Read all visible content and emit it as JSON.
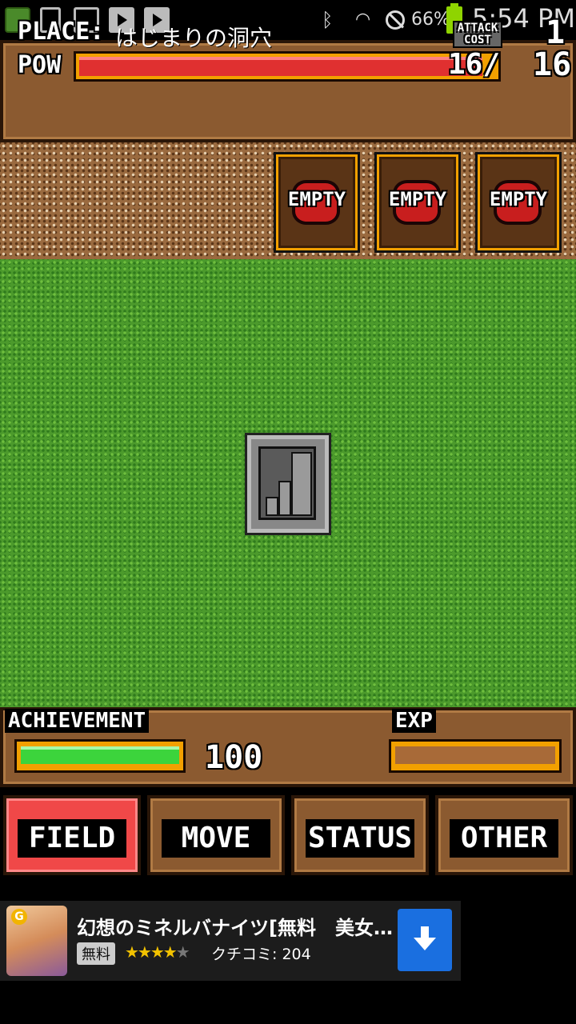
{
  "status_bar": {
    "battery_pct": "66%",
    "time": "5:54 PM",
    "icons": [
      "app-icon",
      "sd-card-icon",
      "image-icon",
      "play-store-icon",
      "play-store-icon",
      "bluetooth-icon",
      "wifi-icon",
      "do-not-disturb-icon",
      "battery-icon"
    ]
  },
  "header": {
    "place_label": "PLACE:",
    "place_value": "はじまりの洞穴",
    "pow_label": "POW",
    "pow_value": "16/",
    "pow_fraction": 0.97,
    "attack_cost_label": "ATTACK COST",
    "attack_cost_value": "1",
    "pow_max": "16"
  },
  "slots": [
    {
      "label": "EMPTY"
    },
    {
      "label": "EMPTY"
    },
    {
      "label": "EMPTY"
    }
  ],
  "footer": {
    "achievement_label": "ACHIEVEMENT",
    "achievement_value": "100",
    "achievement_fraction": 1.0,
    "exp_label": "EXP",
    "exp_fraction": 0.0
  },
  "nav": [
    {
      "label": "FIELD",
      "active": true
    },
    {
      "label": "MOVE",
      "active": false
    },
    {
      "label": "STATUS",
      "active": false
    },
    {
      "label": "OTHER",
      "active": false
    }
  ],
  "ad": {
    "badge": "G",
    "title": "幻想のミネルバナイツ[無料　美女…",
    "free_label": "無料",
    "stars_on": "★★★★",
    "stars_off": "★",
    "rating": 4,
    "review": "クチコミ: 204"
  },
  "colors": {
    "wood": "#8b5a30",
    "pow_bar": "#e03030",
    "achievement_bar": "#3cd43c",
    "active_nav": "#f04848",
    "ad_download": "#1a6fe0"
  }
}
